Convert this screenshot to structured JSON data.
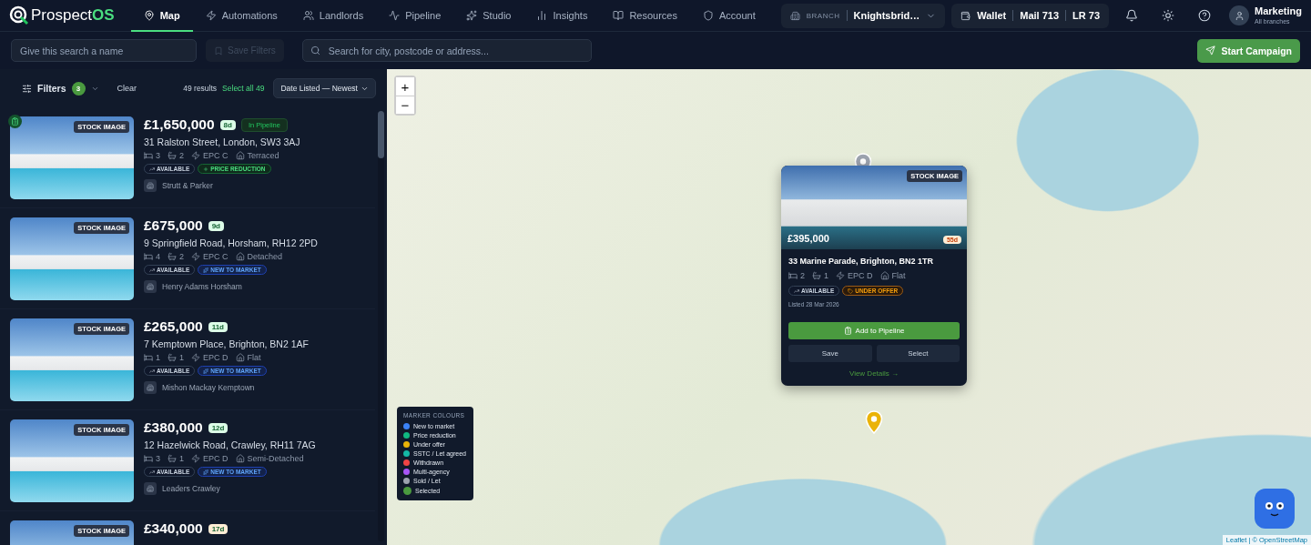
{
  "logo": {
    "text": "Prospect",
    "accent": "OS"
  },
  "nav": [
    {
      "label": "Map",
      "selected": true
    },
    {
      "label": "Automations",
      "selected": false
    },
    {
      "label": "Landlords",
      "selected": false
    },
    {
      "label": "Pipeline",
      "selected": false
    },
    {
      "label": "Studio",
      "selected": false
    },
    {
      "label": "Insights",
      "selected": false
    },
    {
      "label": "Resources",
      "selected": false
    },
    {
      "label": "Account",
      "selected": false
    }
  ],
  "branch": {
    "label": "BRANCH",
    "value": "Knightsbrid…"
  },
  "wallet": {
    "label": "Wallet",
    "mail": "Mail 713",
    "lr": "LR 73"
  },
  "user": {
    "name": "Marketing",
    "scope": "All branches"
  },
  "toolbar": {
    "name_placeholder": "Give this search a name",
    "save_button": {
      "label": "Save Filters",
      "disabled": true
    },
    "search_placeholder": "Search for city, postcode or address...",
    "campaign_button": "Start Campaign"
  },
  "filters": {
    "label": "Filters",
    "count": "3",
    "clear": "Clear",
    "results": "49 results",
    "select_all": "Select all 49",
    "sort": "Date Listed — Newest"
  },
  "listings": [
    {
      "stock": "STOCK IMAGE",
      "in_pipeline": true,
      "price": "£1,650,000",
      "days": "8d",
      "color": "#dcfce7",
      "badge": "In Pipeline",
      "address": "31 Ralston Street, London, SW3 3AJ",
      "beds": "3",
      "baths": "2",
      "epc": "EPC C",
      "type": "Terraced",
      "tags": [
        {
          "label": "AVAILABLE",
          "kind": "status"
        },
        {
          "label": "PRICE REDUCTION",
          "kind": "price"
        }
      ],
      "agent": "Strutt & Parker"
    },
    {
      "stock": "STOCK IMAGE",
      "in_pipeline": false,
      "price": "£675,000",
      "days": "9d",
      "color": "#dcfce7",
      "address": "9 Springfield Road, Horsham, RH12 2PD",
      "beds": "4",
      "baths": "2",
      "epc": "EPC C",
      "type": "Detached",
      "tags": [
        {
          "label": "AVAILABLE",
          "kind": "status"
        },
        {
          "label": "NEW TO MARKET",
          "kind": "new"
        }
      ],
      "agent": "Henry Adams Horsham"
    },
    {
      "stock": "STOCK IMAGE",
      "in_pipeline": false,
      "price": "£265,000",
      "days": "11d",
      "color": "#dcfce7",
      "address": "7 Kemptown Place, Brighton, BN2 1AF",
      "beds": "1",
      "baths": "1",
      "epc": "EPC D",
      "type": "Flat",
      "tags": [
        {
          "label": "AVAILABLE",
          "kind": "status"
        },
        {
          "label": "NEW TO MARKET",
          "kind": "new"
        }
      ],
      "agent": "Mishon Mackay Kemptown"
    },
    {
      "stock": "STOCK IMAGE",
      "in_pipeline": false,
      "price": "£380,000",
      "days": "12d",
      "color": "#dcfce7",
      "address": "12 Hazelwick Road, Crawley, RH11 7AG",
      "beds": "3",
      "baths": "1",
      "epc": "EPC D",
      "type": "Semi-Detached",
      "tags": [
        {
          "label": "AVAILABLE",
          "kind": "status"
        },
        {
          "label": "NEW TO MARKET",
          "kind": "new"
        }
      ],
      "agent": "Leaders Crawley"
    },
    {
      "stock": "STOCK IMAGE",
      "in_pipeline": false,
      "price": "£340,000",
      "days": "17d",
      "color": "#ffedd5"
    }
  ],
  "map": {
    "zoom_in": "+",
    "zoom_out": "−",
    "attribution": "Leaflet | © OpenStreetMap",
    "popup": {
      "stock": "STOCK IMAGE",
      "price": "£395,000",
      "days": "55d",
      "address": "33 Marine Parade, Brighton, BN2 1TR",
      "beds": "2",
      "baths": "1",
      "epc": "EPC D",
      "type": "Flat",
      "tags": [
        {
          "label": "AVAILABLE",
          "kind": "status"
        },
        {
          "label": "UNDER OFFER",
          "kind": "offer"
        }
      ],
      "listed": "Listed 28 Mar 2026",
      "add_button": "Add to Pipeline",
      "save_button": "Save",
      "select_button": "Select",
      "details_link": "View Details →"
    },
    "legend": {
      "title": "MARKER COLOURS",
      "items": [
        {
          "label": "New to market",
          "color": "#3b82f6"
        },
        {
          "label": "Price reduction",
          "color": "#10b981"
        },
        {
          "label": "Under offer",
          "color": "#eab308"
        },
        {
          "label": "SSTC / Let agreed",
          "color": "#14b8a6"
        },
        {
          "label": "Withdrawn",
          "color": "#ef4444"
        },
        {
          "label": "Multi-agency",
          "color": "#a855f7"
        },
        {
          "label": "Sold / Let",
          "color": "#9ca3af"
        },
        {
          "label": "Selected",
          "color": "#4a9a3f"
        }
      ]
    }
  }
}
